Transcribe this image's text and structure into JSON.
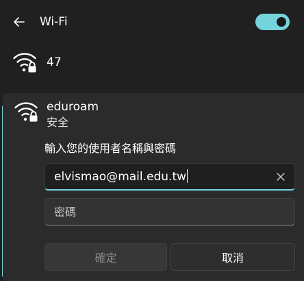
{
  "header": {
    "back_icon": "back-arrow-icon",
    "title": "Wi-Fi",
    "toggle_state": "on",
    "accent_color": "#74d3dc"
  },
  "networks": [
    {
      "name": "47",
      "icon": "wifi-secured-icon"
    }
  ],
  "selected_network": {
    "name": "eduroam",
    "status": "安全",
    "icon": "wifi-secured-icon",
    "prompt": "輸入您的使用者名稱與密碼",
    "username_value": "elvismao@mail.edu.tw",
    "clear_icon": "close-icon",
    "password_placeholder": "密碼",
    "confirm_label": "確定",
    "cancel_label": "取消"
  }
}
